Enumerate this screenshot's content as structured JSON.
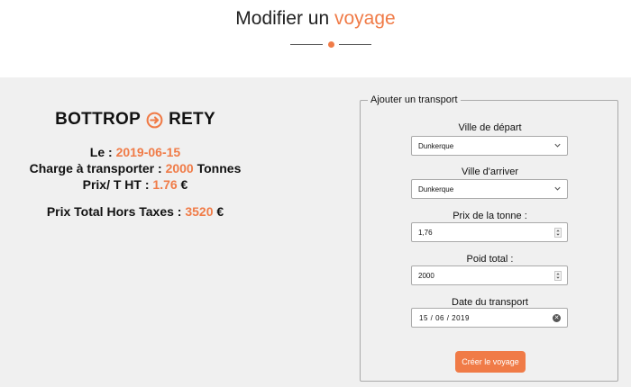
{
  "header": {
    "title_part1": "Modifier un ",
    "title_part2": "voyage",
    "accent_color": "#f07b47"
  },
  "trip": {
    "origin": "BOTTROP",
    "destination": "RETY",
    "route_icon": "arrow-right-circle-icon",
    "date_label": "Le : ",
    "date_value": "2019-06-15",
    "load_label": "Charge à transporter : ",
    "load_value": "2000",
    "load_unit": " Tonnes",
    "price_label": "Prix/ T HT : ",
    "price_value": "1.76",
    "price_unit": " €",
    "total_label": "Prix Total Hors Taxes : ",
    "total_value": "3520",
    "total_unit": " €"
  },
  "form": {
    "legend": "Ajouter un transport",
    "departure_label": "Ville de départ",
    "departure_value": "Dunkerque",
    "arrival_label": "Ville d'arriver",
    "arrival_value": "Dunkerque",
    "price_label": "Prix de la tonne :",
    "price_value": "1,76",
    "weight_label": "Poid total :",
    "weight_value": "2000",
    "date_label": "Date du transport",
    "date_value": "15 / 06 / 2019",
    "submit_label": "Créer le voyage"
  }
}
